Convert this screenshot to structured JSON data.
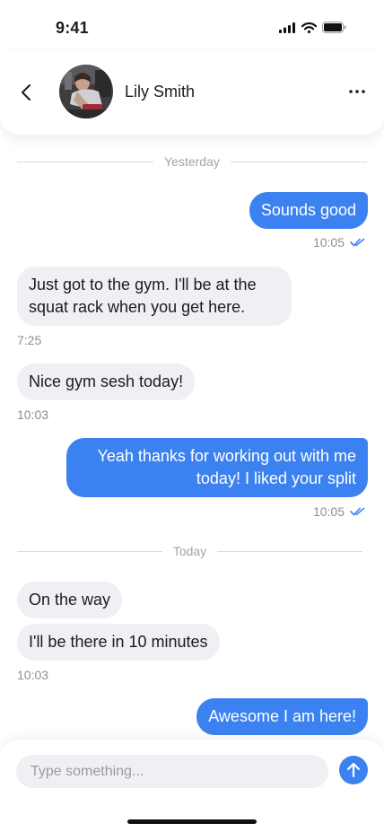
{
  "status_bar": {
    "time": "9:41"
  },
  "header": {
    "contact_name": "Lily Smith"
  },
  "dividers": {
    "yesterday": "Yesterday",
    "today": "Today"
  },
  "messages": [
    {
      "direction": "outgoing",
      "text": "Sounds good",
      "time": "10:05",
      "read": true
    },
    {
      "direction": "incoming",
      "text": "Just got to the gym. I'll be at the squat rack when you get here.",
      "time": "7:25"
    },
    {
      "direction": "incoming",
      "text": "Nice gym sesh today!",
      "time": "10:03"
    },
    {
      "direction": "outgoing",
      "text": "Yeah thanks for working out with me today! I liked your split",
      "time": "10:05",
      "read": true
    },
    {
      "direction": "incoming",
      "text": "On the way"
    },
    {
      "direction": "incoming",
      "text": "I'll be there in 10 minutes",
      "time": "10:03"
    },
    {
      "direction": "outgoing",
      "text": "Awesome I am here!"
    }
  ],
  "composer": {
    "placeholder": "Type something...",
    "value": ""
  },
  "colors": {
    "accent": "#3b82f0",
    "incoming_bubble": "#f0f0f4",
    "read_check": "#3b82f0"
  },
  "icons": {
    "back": "chevron-left-icon",
    "more": "more-horizontal-icon",
    "send": "arrow-up-icon",
    "read": "double-check-icon",
    "signal": "cellular-signal-icon",
    "wifi": "wifi-icon",
    "battery": "battery-icon"
  }
}
